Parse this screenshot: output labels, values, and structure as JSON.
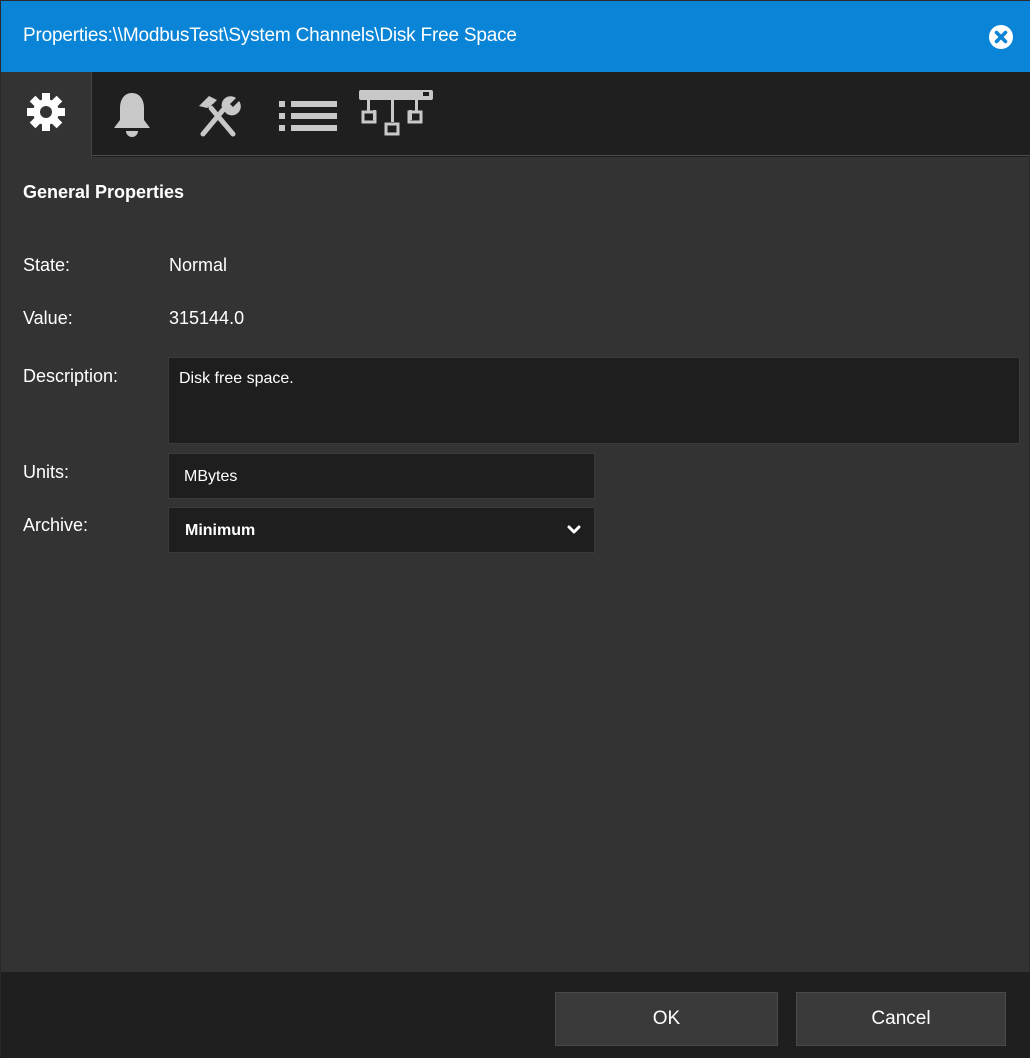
{
  "window": {
    "title": "Properties:\\\\ModbusTest\\System Channels\\Disk Free Space"
  },
  "tabs": [
    {
      "icon": "gear-icon",
      "active": true
    },
    {
      "icon": "bell-icon",
      "active": false
    },
    {
      "icon": "tools-icon",
      "active": false
    },
    {
      "icon": "list-icon",
      "active": false
    },
    {
      "icon": "network-icon",
      "active": false
    }
  ],
  "general": {
    "section_title": "General Properties",
    "state_label": "State:",
    "state_value": "Normal",
    "value_label": "Value:",
    "value_value": "315144.0",
    "description_label": "Description:",
    "description_value": "Disk free space.",
    "units_label": "Units:",
    "units_value": "MBytes",
    "archive_label": "Archive:",
    "archive_value": "Minimum"
  },
  "footer": {
    "ok_label": "OK",
    "cancel_label": "Cancel"
  },
  "colors": {
    "titlebar": "#0a84d6",
    "body": "#333333",
    "field": "#1e1e1e"
  }
}
